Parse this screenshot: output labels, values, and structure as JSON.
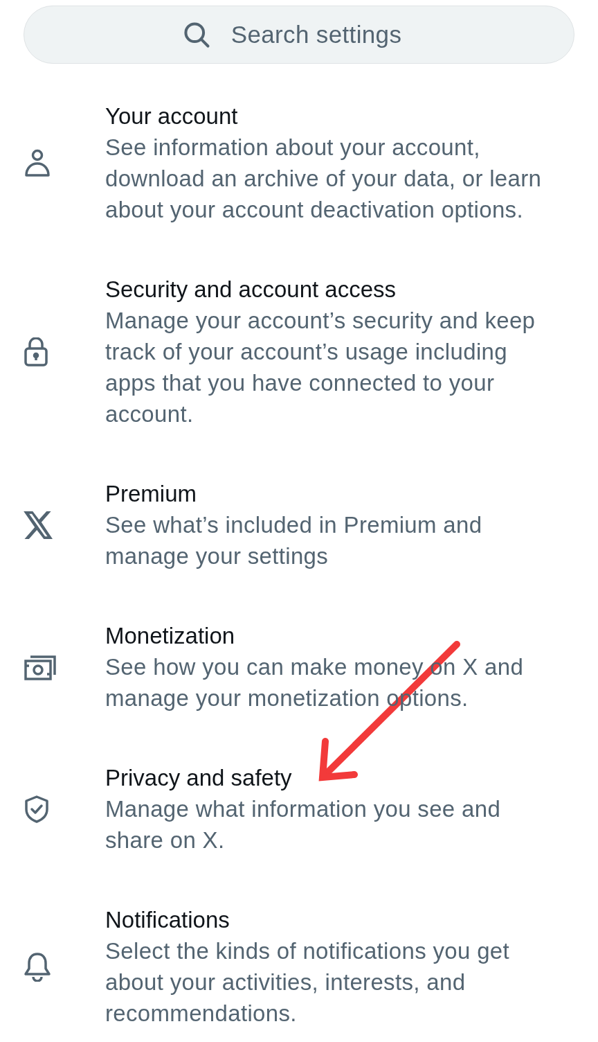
{
  "search": {
    "placeholder": "Search settings"
  },
  "items": [
    {
      "kind": "person",
      "title": "Your account",
      "description": "See information about your account, download an archive of your data, or learn about your account deactivation options."
    },
    {
      "kind": "lock",
      "title": "Security and account access",
      "description": "Manage your account’s security and keep track of your account’s usage including apps that you have connected to your account."
    },
    {
      "kind": "x",
      "title": "Premium",
      "description": "See what’s included in Premium and manage your settings"
    },
    {
      "kind": "money",
      "title": "Monetization",
      "description": "See how you can make money on X and manage your monetization options."
    },
    {
      "kind": "shield",
      "title": "Privacy and safety",
      "description": "Manage what information you see and share on X."
    },
    {
      "kind": "bell",
      "title": "Notifications",
      "description": "Select the kinds of notifications you get about your activities, interests, and recommendations."
    }
  ]
}
